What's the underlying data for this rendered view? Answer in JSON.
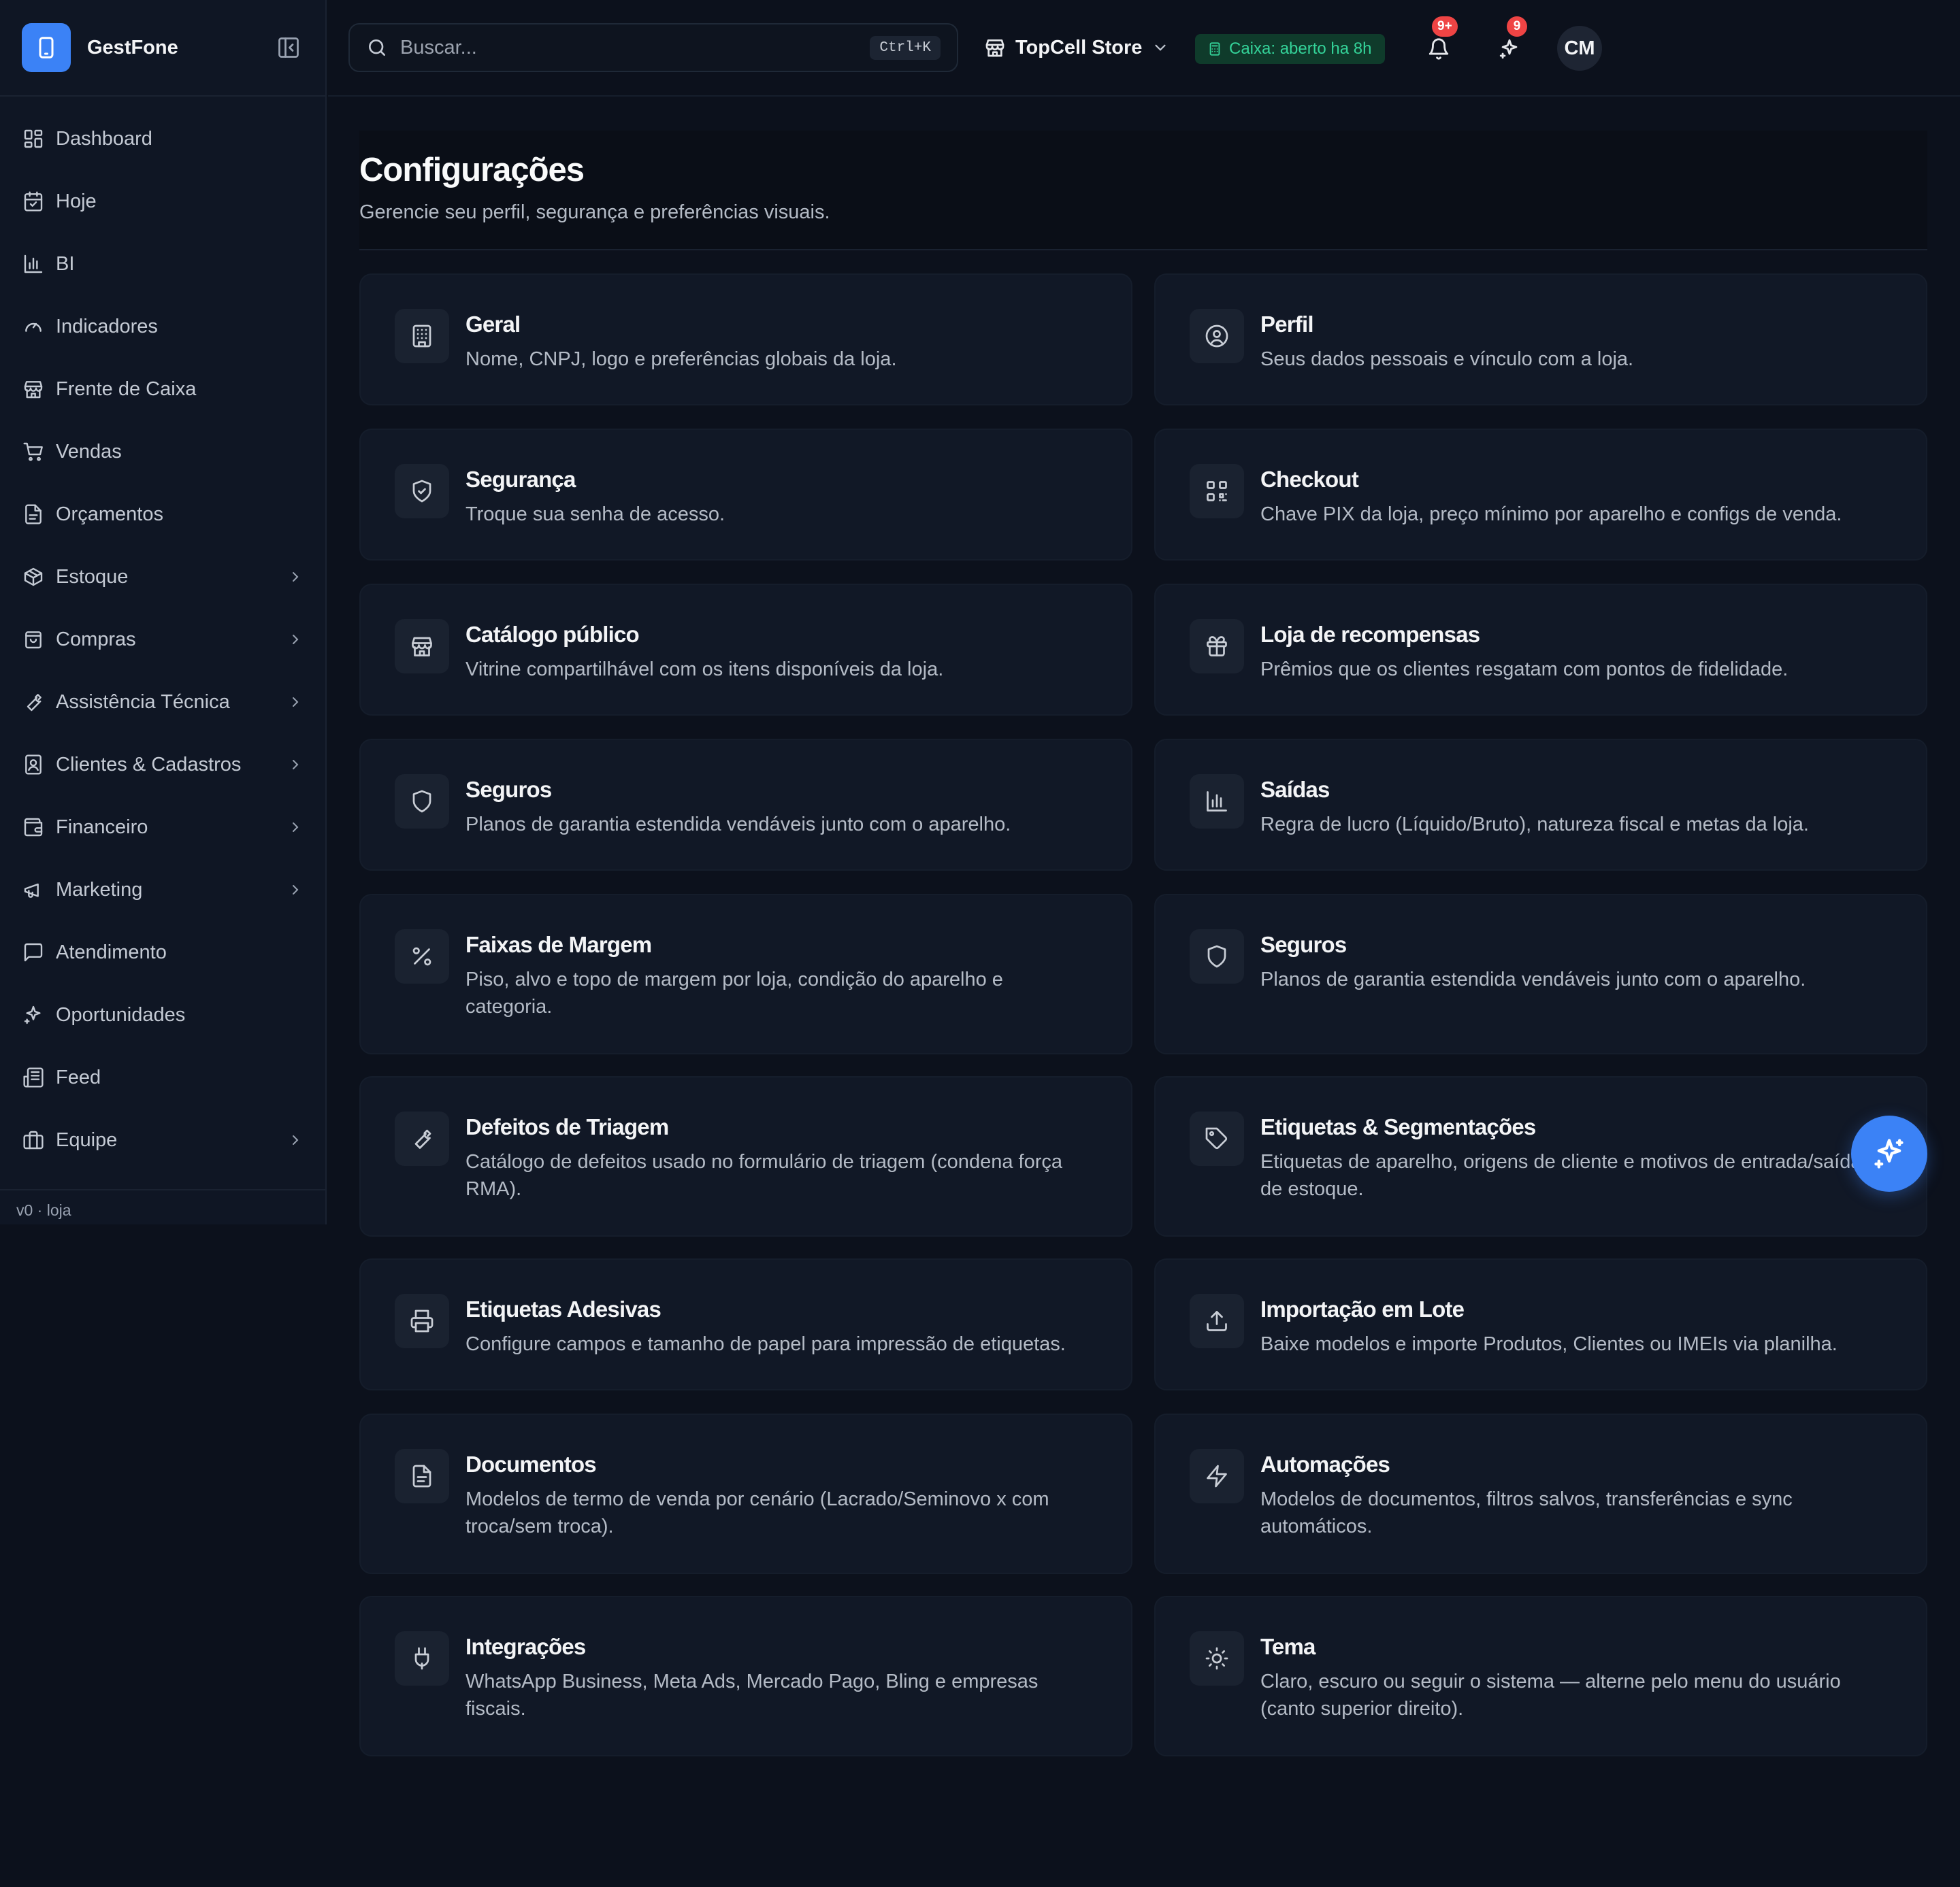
{
  "app": {
    "name": "GestFone",
    "version": "v0 · loja"
  },
  "sidebar": {
    "items": [
      {
        "label": "Dashboard",
        "icon": "dashboard-icon",
        "chevron": false
      },
      {
        "label": "Hoje",
        "icon": "calendar-icon",
        "chevron": false
      },
      {
        "label": "BI",
        "icon": "bar-chart-icon",
        "chevron": false
      },
      {
        "label": "Indicadores",
        "icon": "gauge-icon",
        "chevron": false
      },
      {
        "label": "Frente de Caixa",
        "icon": "store-icon",
        "chevron": false
      },
      {
        "label": "Vendas",
        "icon": "cart-icon",
        "chevron": false
      },
      {
        "label": "Orçamentos",
        "icon": "document-icon",
        "chevron": false
      },
      {
        "label": "Estoque",
        "icon": "package-icon",
        "chevron": true
      },
      {
        "label": "Compras",
        "icon": "shopping-bag-icon",
        "chevron": true
      },
      {
        "label": "Assistência Técnica",
        "icon": "wrench-icon",
        "chevron": true
      },
      {
        "label": "Clientes & Cadastros",
        "icon": "contact-icon",
        "chevron": true
      },
      {
        "label": "Financeiro",
        "icon": "wallet-icon",
        "chevron": true
      },
      {
        "label": "Marketing",
        "icon": "megaphone-icon",
        "chevron": true
      },
      {
        "label": "Atendimento",
        "icon": "message-icon",
        "chevron": false
      },
      {
        "label": "Oportunidades",
        "icon": "sparkles-icon",
        "chevron": false
      },
      {
        "label": "Feed",
        "icon": "newspaper-icon",
        "chevron": false
      },
      {
        "label": "Equipe",
        "icon": "briefcase-icon",
        "chevron": true
      }
    ]
  },
  "topbar": {
    "search_placeholder": "Buscar...",
    "shortcut": "Ctrl+K",
    "store": "TopCell Store",
    "caixa_status": "Caixa: aberto ha 8h",
    "notifications_badge": "9+",
    "ai_badge": "9",
    "avatar_initials": "CM"
  },
  "page": {
    "title": "Configurações",
    "subtitle": "Gerencie seu perfil, segurança e preferências visuais."
  },
  "cards": [
    {
      "title": "Geral",
      "desc": "Nome, CNPJ, logo e preferências globais da loja.",
      "icon": "building-icon"
    },
    {
      "title": "Perfil",
      "desc": "Seus dados pessoais e vínculo com a loja.",
      "icon": "user-circle-icon"
    },
    {
      "title": "Segurança",
      "desc": "Troque sua senha de acesso.",
      "icon": "shield-check-icon"
    },
    {
      "title": "Checkout",
      "desc": "Chave PIX da loja, preço mínimo por aparelho e configs de venda.",
      "icon": "qr-code-icon"
    },
    {
      "title": "Catálogo público",
      "desc": "Vitrine compartilhável com os itens disponíveis da loja.",
      "icon": "store-icon"
    },
    {
      "title": "Loja de recompensas",
      "desc": "Prêmios que os clientes resgatam com pontos de fidelidade.",
      "icon": "gift-icon"
    },
    {
      "title": "Seguros",
      "desc": "Planos de garantia estendida vendáveis junto com o aparelho.",
      "icon": "shield-icon"
    },
    {
      "title": "Saídas",
      "desc": "Regra de lucro (Líquido/Bruto), natureza fiscal e metas da loja.",
      "icon": "bar-chart-icon"
    },
    {
      "title": "Faixas de Margem",
      "desc": "Piso, alvo e topo de margem por loja, condição do aparelho e categoria.",
      "icon": "percent-icon"
    },
    {
      "title": "Seguros",
      "desc": "Planos de garantia estendida vendáveis junto com o aparelho.",
      "icon": "shield-icon"
    },
    {
      "title": "Defeitos de Triagem",
      "desc": "Catálogo de defeitos usado no formulário de triagem (condena força RMA).",
      "icon": "wrench-icon"
    },
    {
      "title": "Etiquetas & Segmentações",
      "desc": "Etiquetas de aparelho, origens de cliente e motivos de entrada/saída de estoque.",
      "icon": "tag-icon"
    },
    {
      "title": "Etiquetas Adesivas",
      "desc": "Configure campos e tamanho de papel para impressão de etiquetas.",
      "icon": "printer-icon"
    },
    {
      "title": "Importação em Lote",
      "desc": "Baixe modelos e importe Produtos, Clientes ou IMEIs via planilha.",
      "icon": "upload-icon"
    },
    {
      "title": "Documentos",
      "desc": "Modelos de termo de venda por cenário (Lacrado/Seminovo x com troca/sem troca).",
      "icon": "document-icon"
    },
    {
      "title": "Automações",
      "desc": "Modelos de documentos, filtros salvos, transferências e sync automáticos.",
      "icon": "zap-icon"
    },
    {
      "title": "Integrações",
      "desc": "WhatsApp Business, Meta Ads, Mercado Pago, Bling e empresas fiscais.",
      "icon": "plug-icon"
    },
    {
      "title": "Tema",
      "desc": "Claro, escuro ou seguir o sistema — alterne pelo menu do usuário (canto superior direito).",
      "icon": "sun-icon"
    }
  ]
}
